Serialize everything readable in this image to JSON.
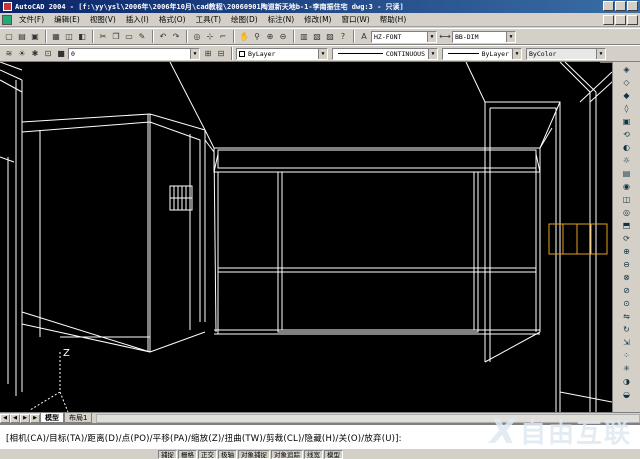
{
  "window": {
    "title": "AutoCAD 2004 - [f:\\yy\\ysl\\2006年\\2006年10月\\cad教程\\20060901陶道新天地b-1-李南振住宅 dwg:3 - 只读]"
  },
  "menu": {
    "items": [
      "文件(F)",
      "编辑(E)",
      "视图(V)",
      "插入(I)",
      "格式(O)",
      "工具(T)",
      "绘图(D)",
      "标注(N)",
      "修改(M)",
      "窗口(W)",
      "帮助(H)"
    ]
  },
  "toolbar": {
    "text_style": "HZ-FONT",
    "dim_style": "BB-DIM"
  },
  "properties": {
    "layer": "0",
    "color": "ByLayer",
    "linetype": "CONTINUOUS",
    "lineweight": "ByLayer",
    "plotstyle": "ByColor"
  },
  "ucs": {
    "axis_label": "Z"
  },
  "tabs": {
    "model": "模型",
    "layout1": "布局1"
  },
  "command": {
    "prompt": "[相机(CA)/目标(TA)/距离(D)/点(PO)/平移(PA)/缩放(Z)/扭曲(TW)/剪裁(CL)/隐藏(H)/关(O)/放弃(U)]:"
  },
  "status": {
    "buttons": [
      "捕捉",
      "栅格",
      "正交",
      "极轴",
      "对象捕捉",
      "对象追踪",
      "线宽",
      "模型"
    ]
  },
  "watermark": {
    "text": "自由互联"
  },
  "colors": {
    "canvas_bg": "#000000",
    "wireframe": "#ffffff",
    "highlight": "#e8a020"
  }
}
